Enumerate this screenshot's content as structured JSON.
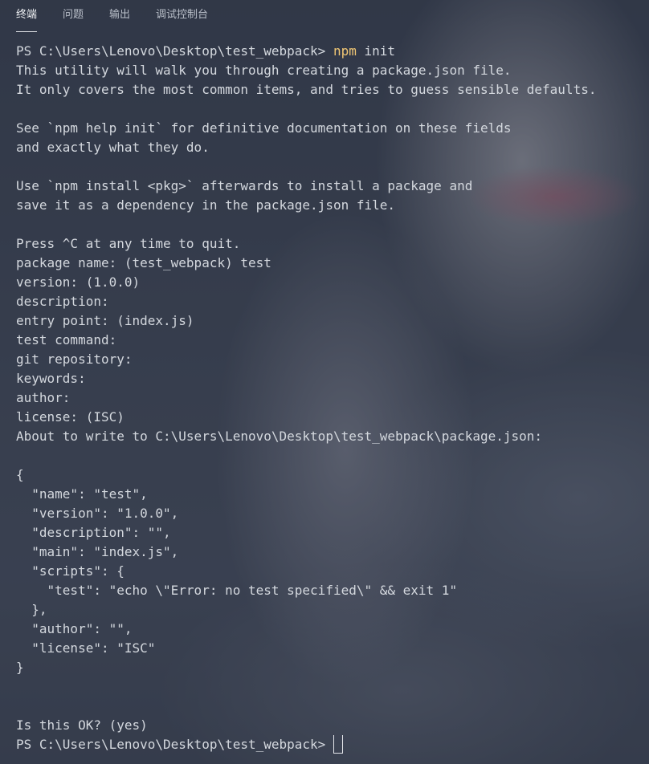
{
  "tabs": [
    {
      "label": "终端",
      "active": true
    },
    {
      "label": "问题",
      "active": false
    },
    {
      "label": "输出",
      "active": false
    },
    {
      "label": "调试控制台",
      "active": false
    }
  ],
  "terminal": {
    "prompt": "PS C:\\Users\\Lenovo\\Desktop\\test_webpack> ",
    "command_name": "npm",
    "command_args": " init",
    "output": [
      "This utility will walk you through creating a package.json file.",
      "It only covers the most common items, and tries to guess sensible defaults.",
      "",
      "See `npm help init` for definitive documentation on these fields",
      "and exactly what they do.",
      "",
      "Use `npm install <pkg>` afterwards to install a package and",
      "save it as a dependency in the package.json file.",
      "",
      "Press ^C at any time to quit.",
      "package name: (test_webpack) test",
      "version: (1.0.0)",
      "description:",
      "entry point: (index.js)",
      "test command:",
      "git repository:",
      "keywords:",
      "author:",
      "license: (ISC)",
      "About to write to C:\\Users\\Lenovo\\Desktop\\test_webpack\\package.json:",
      "",
      "{",
      "  \"name\": \"test\",",
      "  \"version\": \"1.0.0\",",
      "  \"description\": \"\",",
      "  \"main\": \"index.js\",",
      "  \"scripts\": {",
      "    \"test\": \"echo \\\"Error: no test specified\\\" && exit 1\"",
      "  },",
      "  \"author\": \"\",",
      "  \"license\": \"ISC\"",
      "}",
      "",
      "",
      "Is this OK? (yes)"
    ],
    "final_prompt": "PS C:\\Users\\Lenovo\\Desktop\\test_webpack> "
  },
  "colors": {
    "command": "#f0c674",
    "text": "#d4d8de",
    "tab_active": "#f1f3f6",
    "tab_inactive": "#b9bfc9"
  }
}
